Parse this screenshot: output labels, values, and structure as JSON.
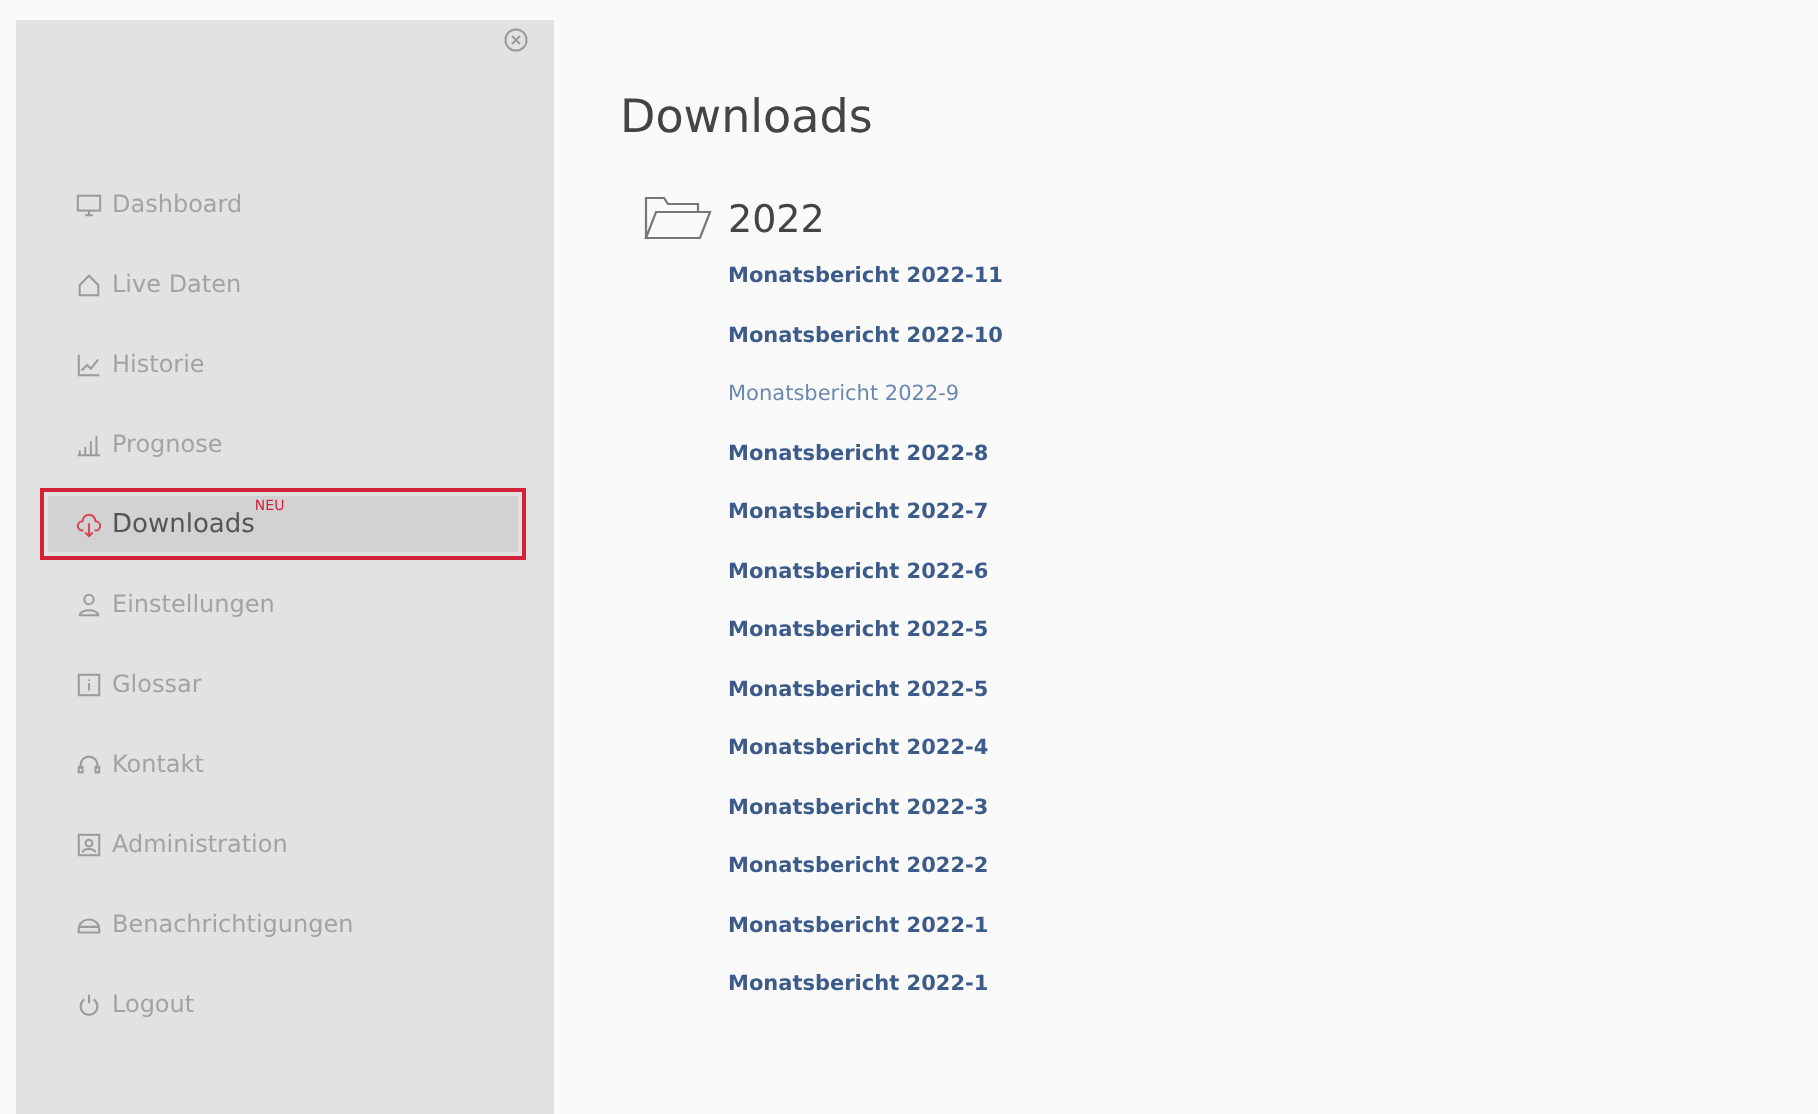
{
  "sidebar": {
    "items": [
      {
        "label": "Dashboard",
        "kind": "monitor",
        "selected": false
      },
      {
        "label": "Live Daten",
        "kind": "house",
        "selected": false
      },
      {
        "label": "Historie",
        "kind": "line",
        "selected": false
      },
      {
        "label": "Prognose",
        "kind": "bars",
        "selected": false
      },
      {
        "label": "Downloads",
        "kind": "cloud",
        "selected": true,
        "badge": "NEU"
      },
      {
        "label": "Einstellungen",
        "kind": "person",
        "selected": false
      },
      {
        "label": "Glossar",
        "kind": "info",
        "selected": false
      },
      {
        "label": "Kontakt",
        "kind": "headset",
        "selected": false
      },
      {
        "label": "Administration",
        "kind": "admin",
        "selected": false
      },
      {
        "label": "Benachrichtigungen",
        "kind": "bell",
        "selected": false
      },
      {
        "label": "Logout",
        "kind": "power",
        "selected": false
      }
    ]
  },
  "main": {
    "title": "Downloads",
    "folder": {
      "name": "2022",
      "links": [
        {
          "label": "Monatsbericht 2022-11",
          "visited": false
        },
        {
          "label": "Monatsbericht 2022-10",
          "visited": false
        },
        {
          "label": "Monatsbericht 2022-9",
          "visited": true
        },
        {
          "label": "Monatsbericht 2022-8",
          "visited": false
        },
        {
          "label": "Monatsbericht 2022-7",
          "visited": false
        },
        {
          "label": "Monatsbericht 2022-6",
          "visited": false
        },
        {
          "label": "Monatsbericht 2022-5",
          "visited": false
        },
        {
          "label": "Monatsbericht 2022-5",
          "visited": false
        },
        {
          "label": "Monatsbericht 2022-4",
          "visited": false
        },
        {
          "label": "Monatsbericht 2022-3",
          "visited": false
        },
        {
          "label": "Monatsbericht 2022-2",
          "visited": false
        },
        {
          "label": "Monatsbericht 2022-1",
          "visited": false
        },
        {
          "label": "Monatsbericht 2022-1",
          "visited": false
        }
      ]
    }
  }
}
